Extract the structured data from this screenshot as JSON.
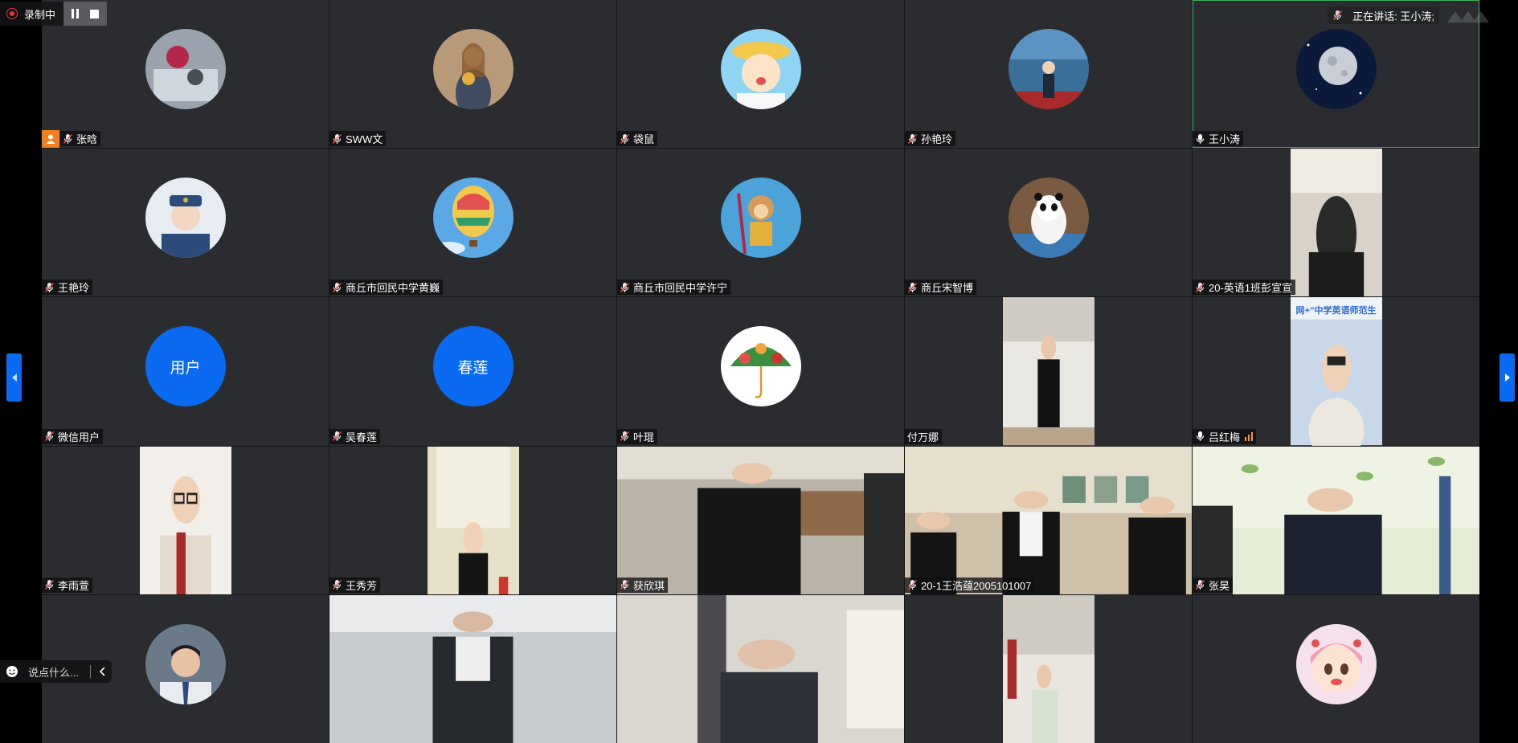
{
  "recording": {
    "label": "录制中"
  },
  "speaking": {
    "label": "正在讲话: 王小涛;"
  },
  "chat": {
    "placeholder": "说点什么..."
  },
  "participants": [
    {
      "name": "张晗",
      "mic": "muted",
      "host": true,
      "display": "avatar",
      "avatar": "photo-doll-car"
    },
    {
      "name": "SWW文",
      "mic": "muted",
      "display": "avatar",
      "avatar": "illustration-woman-flowers"
    },
    {
      "name": "袋鼠",
      "mic": "muted",
      "display": "avatar",
      "avatar": "cartoon-child-hat"
    },
    {
      "name": "孙艳玲",
      "mic": "muted",
      "display": "avatar",
      "avatar": "photo-woman-symposium-banner"
    },
    {
      "name": "王小涛",
      "mic": "on",
      "active": true,
      "display": "avatar",
      "avatar": "moon-night-sky"
    },
    {
      "name": "王艳玲",
      "mic": "muted",
      "display": "avatar",
      "avatar": "photo-woman-uniform"
    },
    {
      "name": "商丘市回民中学黄巍",
      "mic": "muted",
      "display": "avatar",
      "avatar": "hot-air-balloon"
    },
    {
      "name": "商丘市回民中学许宁",
      "mic": "muted",
      "display": "avatar",
      "avatar": "cartoon-monkey-king"
    },
    {
      "name": "商丘宋智博",
      "mic": "muted",
      "display": "avatar",
      "avatar": "panda-mascot"
    },
    {
      "name": "20-英语1班彭宣宣",
      "mic": "muted",
      "display": "video",
      "video": "dark-room-person"
    },
    {
      "name": "微信用户",
      "mic": "muted",
      "display": "text-avatar",
      "avatar_text": "用户"
    },
    {
      "name": "吴春莲",
      "mic": "muted",
      "display": "text-avatar",
      "avatar_text": "春莲"
    },
    {
      "name": "叶琨",
      "mic": "muted",
      "display": "avatar",
      "avatar": "umbrella-of-leaves"
    },
    {
      "name": "付万娜",
      "mic": "none",
      "display": "video",
      "video": "woman-black-suit-standing"
    },
    {
      "name": "吕红梅",
      "mic": "on",
      "signal": true,
      "display": "video",
      "video": "woman-sweater-banner",
      "banner_text": "网+”中学英语师范生"
    },
    {
      "name": "李雨萱",
      "mic": "muted",
      "display": "video",
      "video": "woman-glasses-red-scarf"
    },
    {
      "name": "王秀芳",
      "mic": "muted",
      "display": "video",
      "video": "woman-dorm-curtain"
    },
    {
      "name": "获欣琪",
      "mic": "muted",
      "display": "video-full",
      "video": "dorm-suits-group"
    },
    {
      "name": "20-1王浩蕴2005101007",
      "mic": "muted",
      "display": "video-full",
      "video": "living-room-group"
    },
    {
      "name": "张昊",
      "mic": "muted",
      "display": "video-full",
      "video": "dorm-green-curtain-group"
    },
    {
      "name": "",
      "mic": "none",
      "display": "avatar",
      "avatar": "photo-man-tie"
    },
    {
      "name": "",
      "mic": "none",
      "display": "video-full",
      "video": "blurred-woman-suit"
    },
    {
      "name": "",
      "mic": "none",
      "display": "video-full",
      "video": "man-glasses-jacket"
    },
    {
      "name": "",
      "mic": "none",
      "display": "video",
      "video": "woman-green-top-room"
    },
    {
      "name": "",
      "mic": "none",
      "display": "avatar",
      "avatar": "cartoon-pink-hair-girl"
    }
  ],
  "colors": {
    "tile_bg": "#2a2c2f",
    "active_border": "#3cb35a",
    "accent_blue": "#0a6bf2",
    "record_red": "#e23a3a",
    "host_orange": "#f0801f"
  },
  "icons": [
    "record-dot-icon",
    "pause-icon",
    "stop-icon",
    "mic-muted-icon",
    "mic-icon",
    "host-icon",
    "signal-icon",
    "chevron-left-icon",
    "chevron-right-icon",
    "emoji-icon",
    "collapse-chevron-icon"
  ]
}
